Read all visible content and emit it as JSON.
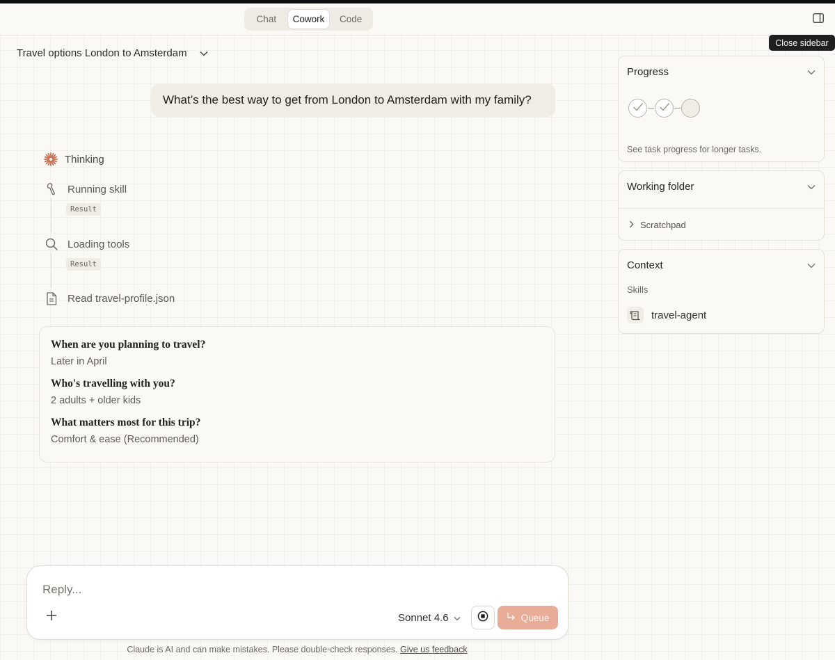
{
  "topbar": {
    "tabs": [
      {
        "label": "Chat",
        "active": false
      },
      {
        "label": "Cowork",
        "active": true
      },
      {
        "label": "Code",
        "active": false
      }
    ],
    "sidebar_tooltip": "Close sidebar"
  },
  "conversation": {
    "title": "Travel options London to Amsterdam",
    "user_message": "What’s the best way to get from London to Amsterdam with my family?"
  },
  "steps": {
    "thinking": "Thinking",
    "items": [
      {
        "label": "Running skill",
        "icon": "skill-icon",
        "result": "Result"
      },
      {
        "label": "Loading tools",
        "icon": "search-icon",
        "result": "Result"
      },
      {
        "label": "Read travel-profile.json",
        "icon": "file-icon"
      }
    ]
  },
  "answers": [
    {
      "question": "When are you planning to travel?",
      "answer": "Later in April"
    },
    {
      "question": "Who's travelling with you?",
      "answer": "2 adults + older kids"
    },
    {
      "question": "What matters most for this trip?",
      "answer": "Comfort & ease (Recommended)"
    }
  ],
  "composer": {
    "placeholder": "Reply...",
    "model": "Sonnet 4.6",
    "queue_label": "Queue"
  },
  "footer": {
    "disclaimer": "Claude is AI and can make mistakes. Please double-check responses.",
    "feedback_link": "Give us feedback"
  },
  "sidebar": {
    "progress": {
      "title": "Progress",
      "completed_steps": 2,
      "total_steps": 3,
      "hint": "See task progress for longer tasks."
    },
    "working_folder": {
      "title": "Working folder",
      "folder": "Scratchpad"
    },
    "context": {
      "title": "Context",
      "skills_label": "Skills",
      "skill": "travel-agent"
    }
  },
  "colors": {
    "accent": "#e9ac99",
    "background": "#faf9f5",
    "thinking_icon": "#c96f52"
  }
}
